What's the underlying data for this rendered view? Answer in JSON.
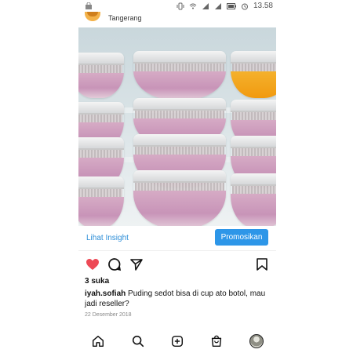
{
  "location": "Tangerang",
  "status_bar": {
    "time": "13.58",
    "icons": [
      "vibrate-icon",
      "wifi-icon",
      "signal-icon",
      "signal-icon",
      "battery-icon",
      "alarm-icon"
    ]
  },
  "post": {
    "insight_link": "Lihat Insight",
    "promote_button": "Promosikan",
    "likes": "3 suka",
    "username": "iyah.sofiah",
    "caption": "Puding sedot bisa di cup ato botol, mau jadi reseller?",
    "date": "22 Desember 2018",
    "image_icon": "pudding-cups-photo"
  },
  "actions": {
    "like_icon": "heart-icon",
    "comment_icon": "comment-icon",
    "share_icon": "send-icon",
    "save_icon": "bookmark-icon"
  },
  "nav": {
    "home_icon": "home-icon",
    "search_icon": "search-icon",
    "add_icon": "add-post-icon",
    "shop_icon": "shop-icon",
    "profile_icon": "profile-avatar"
  },
  "colors": {
    "accent": "#2d96e8",
    "link": "#2f8fd8",
    "heart": "#ed4956",
    "pudding_pink": "#c894b8",
    "pudding_orange": "#f19a10"
  }
}
